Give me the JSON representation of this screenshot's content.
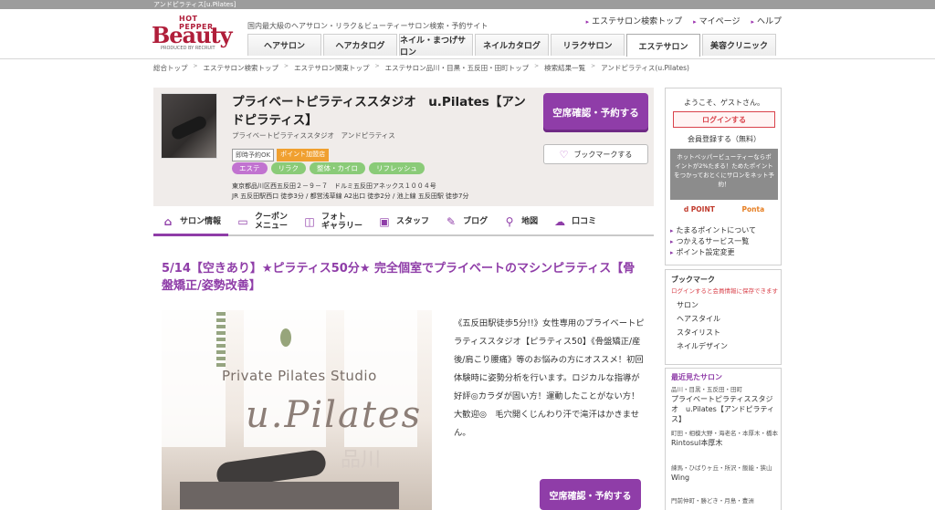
{
  "window": {
    "tab_title": "アンドピラティス[u.Pilates]"
  },
  "header": {
    "brand_hp": "HOT PEPPER",
    "brand_name": "Beauty",
    "brand_produced": "PRODUCED BY RECRUIT",
    "tagline": "国内最大級のヘアサロン・リラク＆ビューティーサロン検索・予約サイト",
    "links": [
      "エステサロン検索トップ",
      "マイページ",
      "ヘルプ"
    ],
    "tabs": [
      "ヘアサロン",
      "ヘアカタログ",
      "ネイル・まつげサロン",
      "ネイルカタログ",
      "リラクサロン",
      "エステサロン",
      "美容クリニック"
    ],
    "active_tab": "エステサロン"
  },
  "breadcrumb": [
    "総合トップ",
    "エステサロン検索トップ",
    "エステサロン関東トップ",
    "エステサロン品川・目黒・五反田・田町トップ",
    "検索結果一覧",
    "アンドピラティス(u.Pilates)"
  ],
  "salon": {
    "name": "プライベートピラティススタジオ　u.Pilates【アンドピラティス】",
    "subname": "プライベートピラティススタジオ　アンドピラティス",
    "badge_instant": "即時予約OK",
    "badge_points": "ポイント加盟店",
    "categories": [
      "エステ",
      "リラク",
      "整体・カイロ",
      "リフレッシュ"
    ],
    "address": "東京都品川区西五反田２－９－７　ドルミ五反田アネックス１００４号",
    "access": "JR 五反田駅西口 徒歩3分 / 都営浅草線 A2出口 徒歩2分 / 池上線 五反田駅 徒歩7分",
    "reserve_label": "空席確認・予約する",
    "bookmark_label": "ブックマークする"
  },
  "tabs": [
    {
      "label": "サロン情報",
      "icon": "home-icon"
    },
    {
      "label": "クーポン\nメニュー",
      "icon": "coupon-icon"
    },
    {
      "label": "フォト\nギャラリー",
      "icon": "photo-icon"
    },
    {
      "label": "スタッフ",
      "icon": "staff-icon"
    },
    {
      "label": "ブログ",
      "icon": "pen-icon"
    },
    {
      "label": "地図",
      "icon": "map-pin-icon"
    },
    {
      "label": "口コミ",
      "icon": "chat-icon"
    }
  ],
  "main": {
    "headline": "5/14【空きあり】★ピラティス50分★ 完全個室でプライベートのマシンピラティス【骨盤矯正/姿勢改善】",
    "photo_text1": "Private Pilates Studio",
    "photo_text2": "u.Pilates",
    "photo_text3": "品川",
    "description": "《五反田駅徒歩5分!!》女性専用のプライベートピラティススタジオ【ピラティス50】《骨盤矯正/産後/肩こり腰痛》等のお悩みの方にオススメ！初回体験時に姿勢分析を行います。ロジカルな指導が好評◎カラダが固い方！運動したことがない方！大歓迎◎　毛穴開くじんわり汗で滝汗はかきません。",
    "reserve_label": "空席確認・予約する"
  },
  "sidebar": {
    "welcome": "ようこそ、ゲストさん。",
    "login": "ログインする",
    "register": "会員登録する（無料）",
    "points_text": "ホットペッパービューティーならポイントが2%たまる！ためたポイントをつかっておとくにサロンをネット予約！",
    "logo_dpoint": "d POINT",
    "logo_ponta": "Ponta",
    "links": [
      "たまるポイントについて",
      "つかえるサービス一覧",
      "ポイント設定変更"
    ],
    "bookmark_title": "ブックマーク",
    "bookmark_note": "ログインすると会員情報に保存できます",
    "bookmark_items": [
      "サロン",
      "ヘアスタイル",
      "スタイリスト",
      "ネイルデザイン"
    ],
    "recent_title": "最近見たサロン",
    "recent": [
      {
        "area": "品川・目黒・五反田・田町",
        "name": "プライベートピラティススタジオ　u.Pilates【アンドピラティス】"
      },
      {
        "area": "町田・相模大野・海老名・本厚木・橋本",
        "name": "Rintosul本厚木"
      },
      {
        "area": "練馬・ひばりヶ丘・所沢・飯能・狭山",
        "name": "Wing"
      },
      {
        "area": "門前仲町・勝どき・月島・豊洲",
        "name": ""
      }
    ]
  }
}
